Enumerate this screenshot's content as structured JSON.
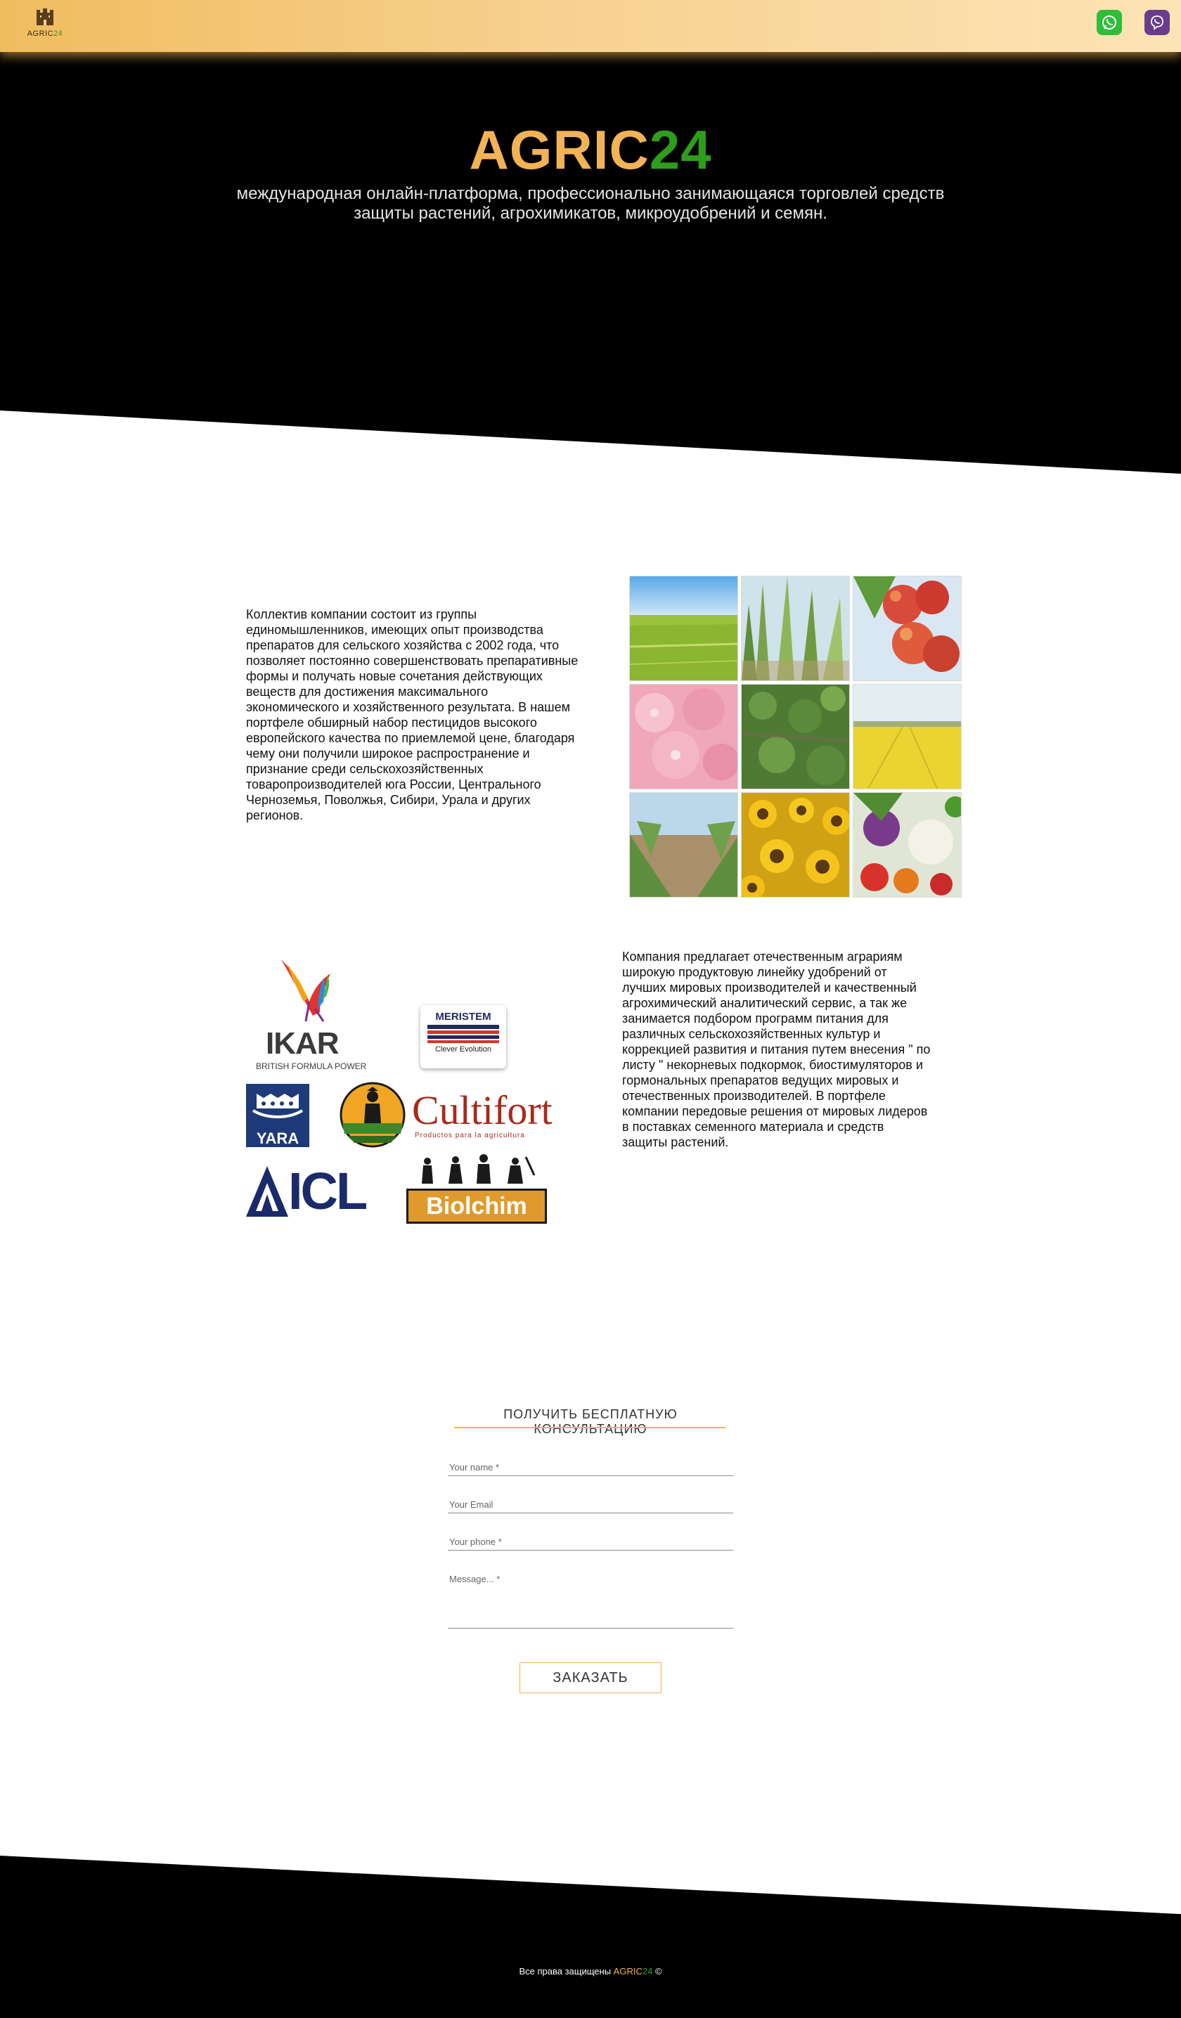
{
  "header": {
    "logo_text": "AGRIC",
    "logo_num": "24",
    "whatsapp": "whatsapp-icon",
    "viber": "viber-icon"
  },
  "hero": {
    "title_a": "AGRIC",
    "title_b": "24",
    "subtitle": "международная онлайн-платформа, профессионально занимающаяся торговлей средств защиты растений, агрохимикатов, микроудобрений и семян."
  },
  "about": {
    "text": "Коллектив компании состоит из группы единомышленников, имеющих опыт производства препаратов для сельского хозяйства с 2002 года, что позволяет постоянно совершенствовать препаративные формы и получать новые сочетания действующих веществ для достижения максимального экономического и хозяйственного результата. В нашем портфеле обширный набор пестицидов высокого европейского качества по приемлемой цене, благодаря чему они получили широкое распространение и признание среди сельскохозяйственных товаропроизводителей юга России, Центрального Черноземья, Поволжья, Сибири, Урала и других регионов.",
    "photos": [
      "wheat-field",
      "corn-field",
      "apples",
      "pink-flowers",
      "potato-field",
      "rapeseed-field",
      "beet-rows",
      "sunflowers",
      "vegetables"
    ]
  },
  "partners": {
    "ikar_name": "IKAR",
    "ikar_tagline": "BRITISH FORMULA POWER",
    "meristem_name": "MERISTEM",
    "meristem_tagline": "Clever Evolution",
    "yara_name": "YARA",
    "cultifort_name": "Cultifort",
    "cultifort_tagline": "Productos para la agricultura",
    "icl_name": "ICL",
    "biolchim_name": "Biolchim",
    "text": "Компания предлагает отечественным аграриям широкую продуктовую линейку удобрений от лучших мировых производителей и качественный агрохимический аналитический сервис, а так же занимается подбором программ питания для различных сельскохозяйственных культур и коррекцией развития и питания путем внесения \" по листу \" некорневых подкормок, биостимуляторов и гормональных препаратов ведущих мировых и отечественных производителей. В портфеле компании передовые решения от мировых лидеров в поставках семенного материала и средств защиты растений."
  },
  "form": {
    "title": "ПОЛУЧИТЬ БЕСПЛАТНУЮ КОНСУЛЬТАЦИЮ",
    "name_placeholder": "Your name *",
    "email_placeholder": "Your Email",
    "phone_placeholder": "Your phone *",
    "message_placeholder": "Message... *",
    "submit_label": "ЗАКАЗАТЬ"
  },
  "footer": {
    "rights": "Все права защищены",
    "brand_a": "AGRIC",
    "brand_b": "24",
    "copyright": "©"
  },
  "colors": {
    "accent_orange": "#f1b355",
    "accent_green": "#2e9d1c",
    "hero_bg": "#000000"
  }
}
